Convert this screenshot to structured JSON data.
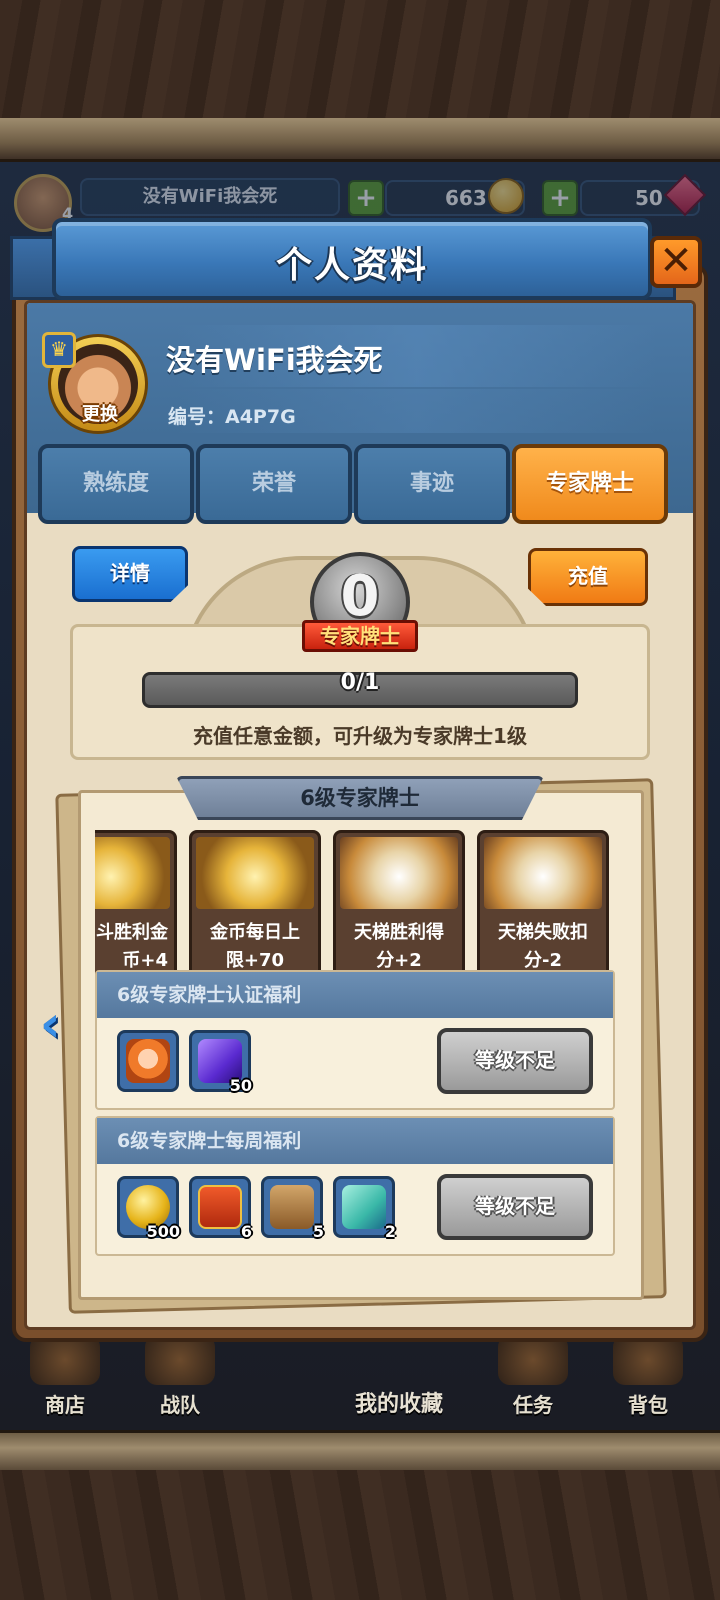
{
  "hud": {
    "player_name": "没有WiFi我会死",
    "level": "4",
    "coins": "663",
    "gems": "50"
  },
  "bottom_nav": {
    "items": [
      {
        "label": "商店",
        "icon": "shop-icon"
      },
      {
        "label": "战队",
        "icon": "team-icon"
      },
      {
        "label": "任务",
        "icon": "quest-icon"
      },
      {
        "label": "背包",
        "icon": "bag-icon"
      }
    ],
    "center_label": "我的收藏"
  },
  "modal": {
    "title": "个人资料",
    "close_icon": "close-icon",
    "avatar_change_label": "更换",
    "player_name": "没有WiFi我会死",
    "player_id": "编号：A4P7G",
    "tabs": [
      {
        "label": "熟练度",
        "active": false
      },
      {
        "label": "荣誉",
        "active": false
      },
      {
        "label": "事迹",
        "active": false
      },
      {
        "label": "专家牌士",
        "active": true
      }
    ]
  },
  "expert": {
    "detail_button": "详情",
    "recharge_button": "充值",
    "current_level": "0",
    "rank_name": "专家牌士",
    "progress_text": "0/1",
    "progress_fraction": 0,
    "upgrade_hint": "充值任意金额，可升级为专家牌士1级"
  },
  "level_panel": {
    "title": "6级专家牌士",
    "perks": [
      {
        "label": "斗胜利金币+4",
        "line1": "斗胜利金",
        "line2": "币+4"
      },
      {
        "label": "金币每日上限+70",
        "line1": "金币每日上",
        "line2": "限+70"
      },
      {
        "label": "天梯胜利得分+2",
        "line1": "天梯胜利得",
        "line2": "分+2"
      },
      {
        "label": "天梯失败扣分-2",
        "line1": "天梯失败扣",
        "line2": "分-2"
      }
    ],
    "certification": {
      "title": "6级专家牌士认证福利",
      "rewards": [
        {
          "icon": "portrait-icon",
          "count": ""
        },
        {
          "icon": "card-pack-icon",
          "count": "50"
        }
      ],
      "button": "等级不足"
    },
    "weekly": {
      "title": "6级专家牌士每周福利",
      "rewards": [
        {
          "icon": "gold-coin-icon",
          "count": "500"
        },
        {
          "icon": "treasure-chest-icon",
          "count": "6"
        },
        {
          "icon": "card-bag-icon",
          "count": "5"
        },
        {
          "icon": "ticket-icon",
          "count": "2"
        }
      ],
      "button": "等级不足"
    }
  },
  "colors": {
    "accent_blue": "#3a78b8",
    "accent_orange": "#f08a1c",
    "parchment": "#f4ead3"
  }
}
